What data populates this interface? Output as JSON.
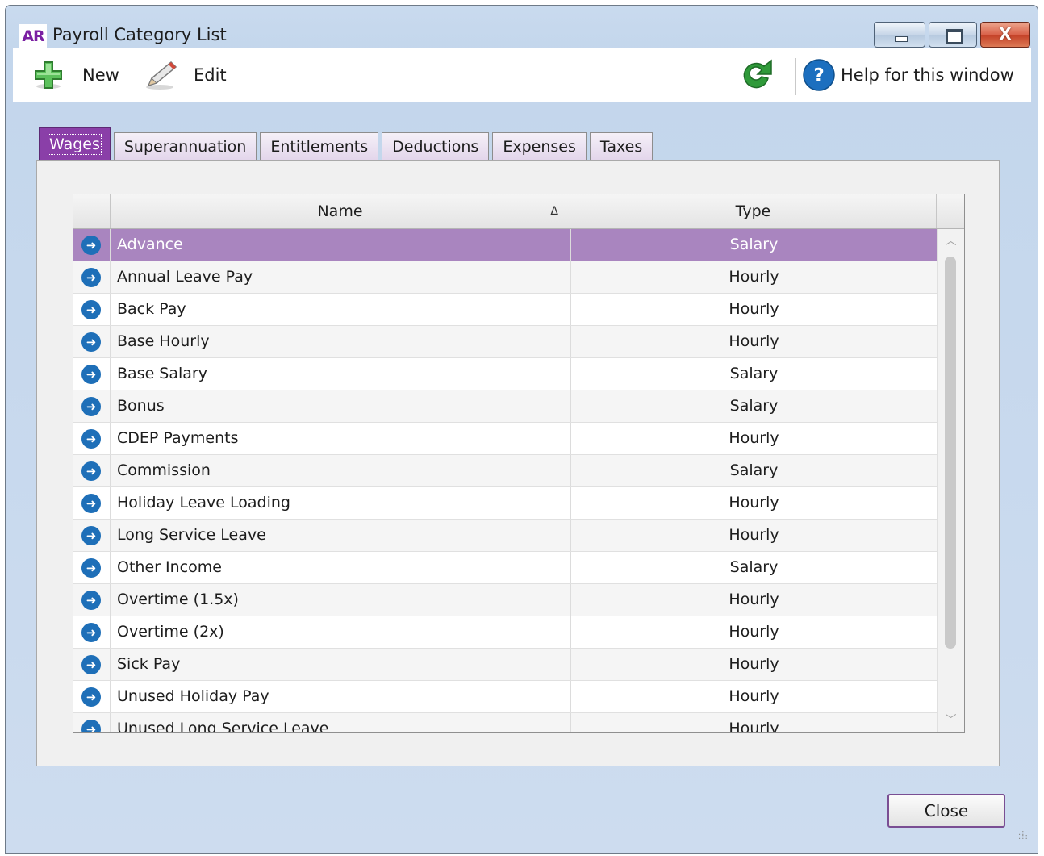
{
  "window": {
    "app_badge": "AR",
    "title": "Payroll Category List",
    "controls": {
      "minimize": "minimize",
      "maximize": "maximize",
      "close": "X"
    }
  },
  "toolbar": {
    "new_label": "New",
    "edit_label": "Edit",
    "help_label": "Help for this window",
    "icons": {
      "new": "plus-icon",
      "edit": "pencil-icon",
      "refresh": "refresh-icon",
      "help": "help-icon"
    }
  },
  "tabs": [
    {
      "label": "Wages",
      "active": true
    },
    {
      "label": "Superannuation",
      "active": false
    },
    {
      "label": "Entitlements",
      "active": false
    },
    {
      "label": "Deductions",
      "active": false
    },
    {
      "label": "Expenses",
      "active": false
    },
    {
      "label": "Taxes",
      "active": false
    }
  ],
  "grid": {
    "columns": {
      "name": "Name",
      "type": "Type"
    },
    "sort_indicator": "Δ",
    "rows": [
      {
        "name": "Advance",
        "type": "Salary",
        "selected": true
      },
      {
        "name": "Annual Leave Pay",
        "type": "Hourly"
      },
      {
        "name": "Back Pay",
        "type": "Hourly"
      },
      {
        "name": "Base Hourly",
        "type": "Hourly"
      },
      {
        "name": "Base Salary",
        "type": "Salary"
      },
      {
        "name": "Bonus",
        "type": "Salary"
      },
      {
        "name": "CDEP Payments",
        "type": "Hourly"
      },
      {
        "name": "Commission",
        "type": "Salary"
      },
      {
        "name": "Holiday Leave Loading",
        "type": "Hourly"
      },
      {
        "name": "Long Service Leave",
        "type": "Hourly"
      },
      {
        "name": "Other Income",
        "type": "Salary"
      },
      {
        "name": "Overtime (1.5x)",
        "type": "Hourly"
      },
      {
        "name": "Overtime (2x)",
        "type": "Hourly"
      },
      {
        "name": "Sick Pay",
        "type": "Hourly"
      },
      {
        "name": "Unused Holiday Pay",
        "type": "Hourly"
      },
      {
        "name": "Unused Long Service Leave",
        "type": "Hourly"
      }
    ]
  },
  "footer": {
    "close_label": "Close"
  },
  "colors": {
    "accent": "#8a3fa8",
    "selected_row": "#a985bf",
    "row_arrow": "#1e6fb8"
  }
}
